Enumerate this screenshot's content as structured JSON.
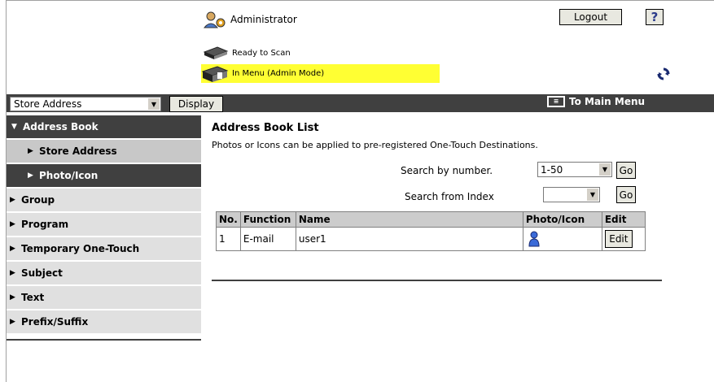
{
  "header": {
    "user_label": "Administrator",
    "logout_label": "Logout",
    "help_label": "?",
    "status_ready": "Ready to Scan",
    "status_mode": "In Menu (Admin Mode)"
  },
  "toolbar": {
    "select_value": "Store Address",
    "display_label": "Display",
    "main_menu_label": "To Main Menu"
  },
  "sidebar": {
    "items": [
      {
        "label": "Address Book"
      },
      {
        "label": "Store Address"
      },
      {
        "label": "Photo/Icon"
      },
      {
        "label": "Group"
      },
      {
        "label": "Program"
      },
      {
        "label": "Temporary One-Touch"
      },
      {
        "label": "Subject"
      },
      {
        "label": "Text"
      },
      {
        "label": "Prefix/Suffix"
      }
    ]
  },
  "main": {
    "title": "Address Book List",
    "description": "Photos or Icons can be applied to pre-registered One-Touch Destinations.",
    "search_number_label": "Search by number.",
    "search_number_value": "1-50",
    "search_index_label": "Search from Index",
    "go_label": "Go",
    "table": {
      "headers": [
        "No.",
        "Function",
        "Name",
        "Photo/Icon",
        "Edit"
      ],
      "rows": [
        {
          "no": "1",
          "function": "E-mail",
          "name": "user1",
          "icon": "person-icon",
          "edit": "Edit"
        }
      ]
    }
  },
  "colors": {
    "dark_bar": "#404040",
    "status_highlight": "#ffff33",
    "sidebar_light": "#e0e0e0"
  }
}
